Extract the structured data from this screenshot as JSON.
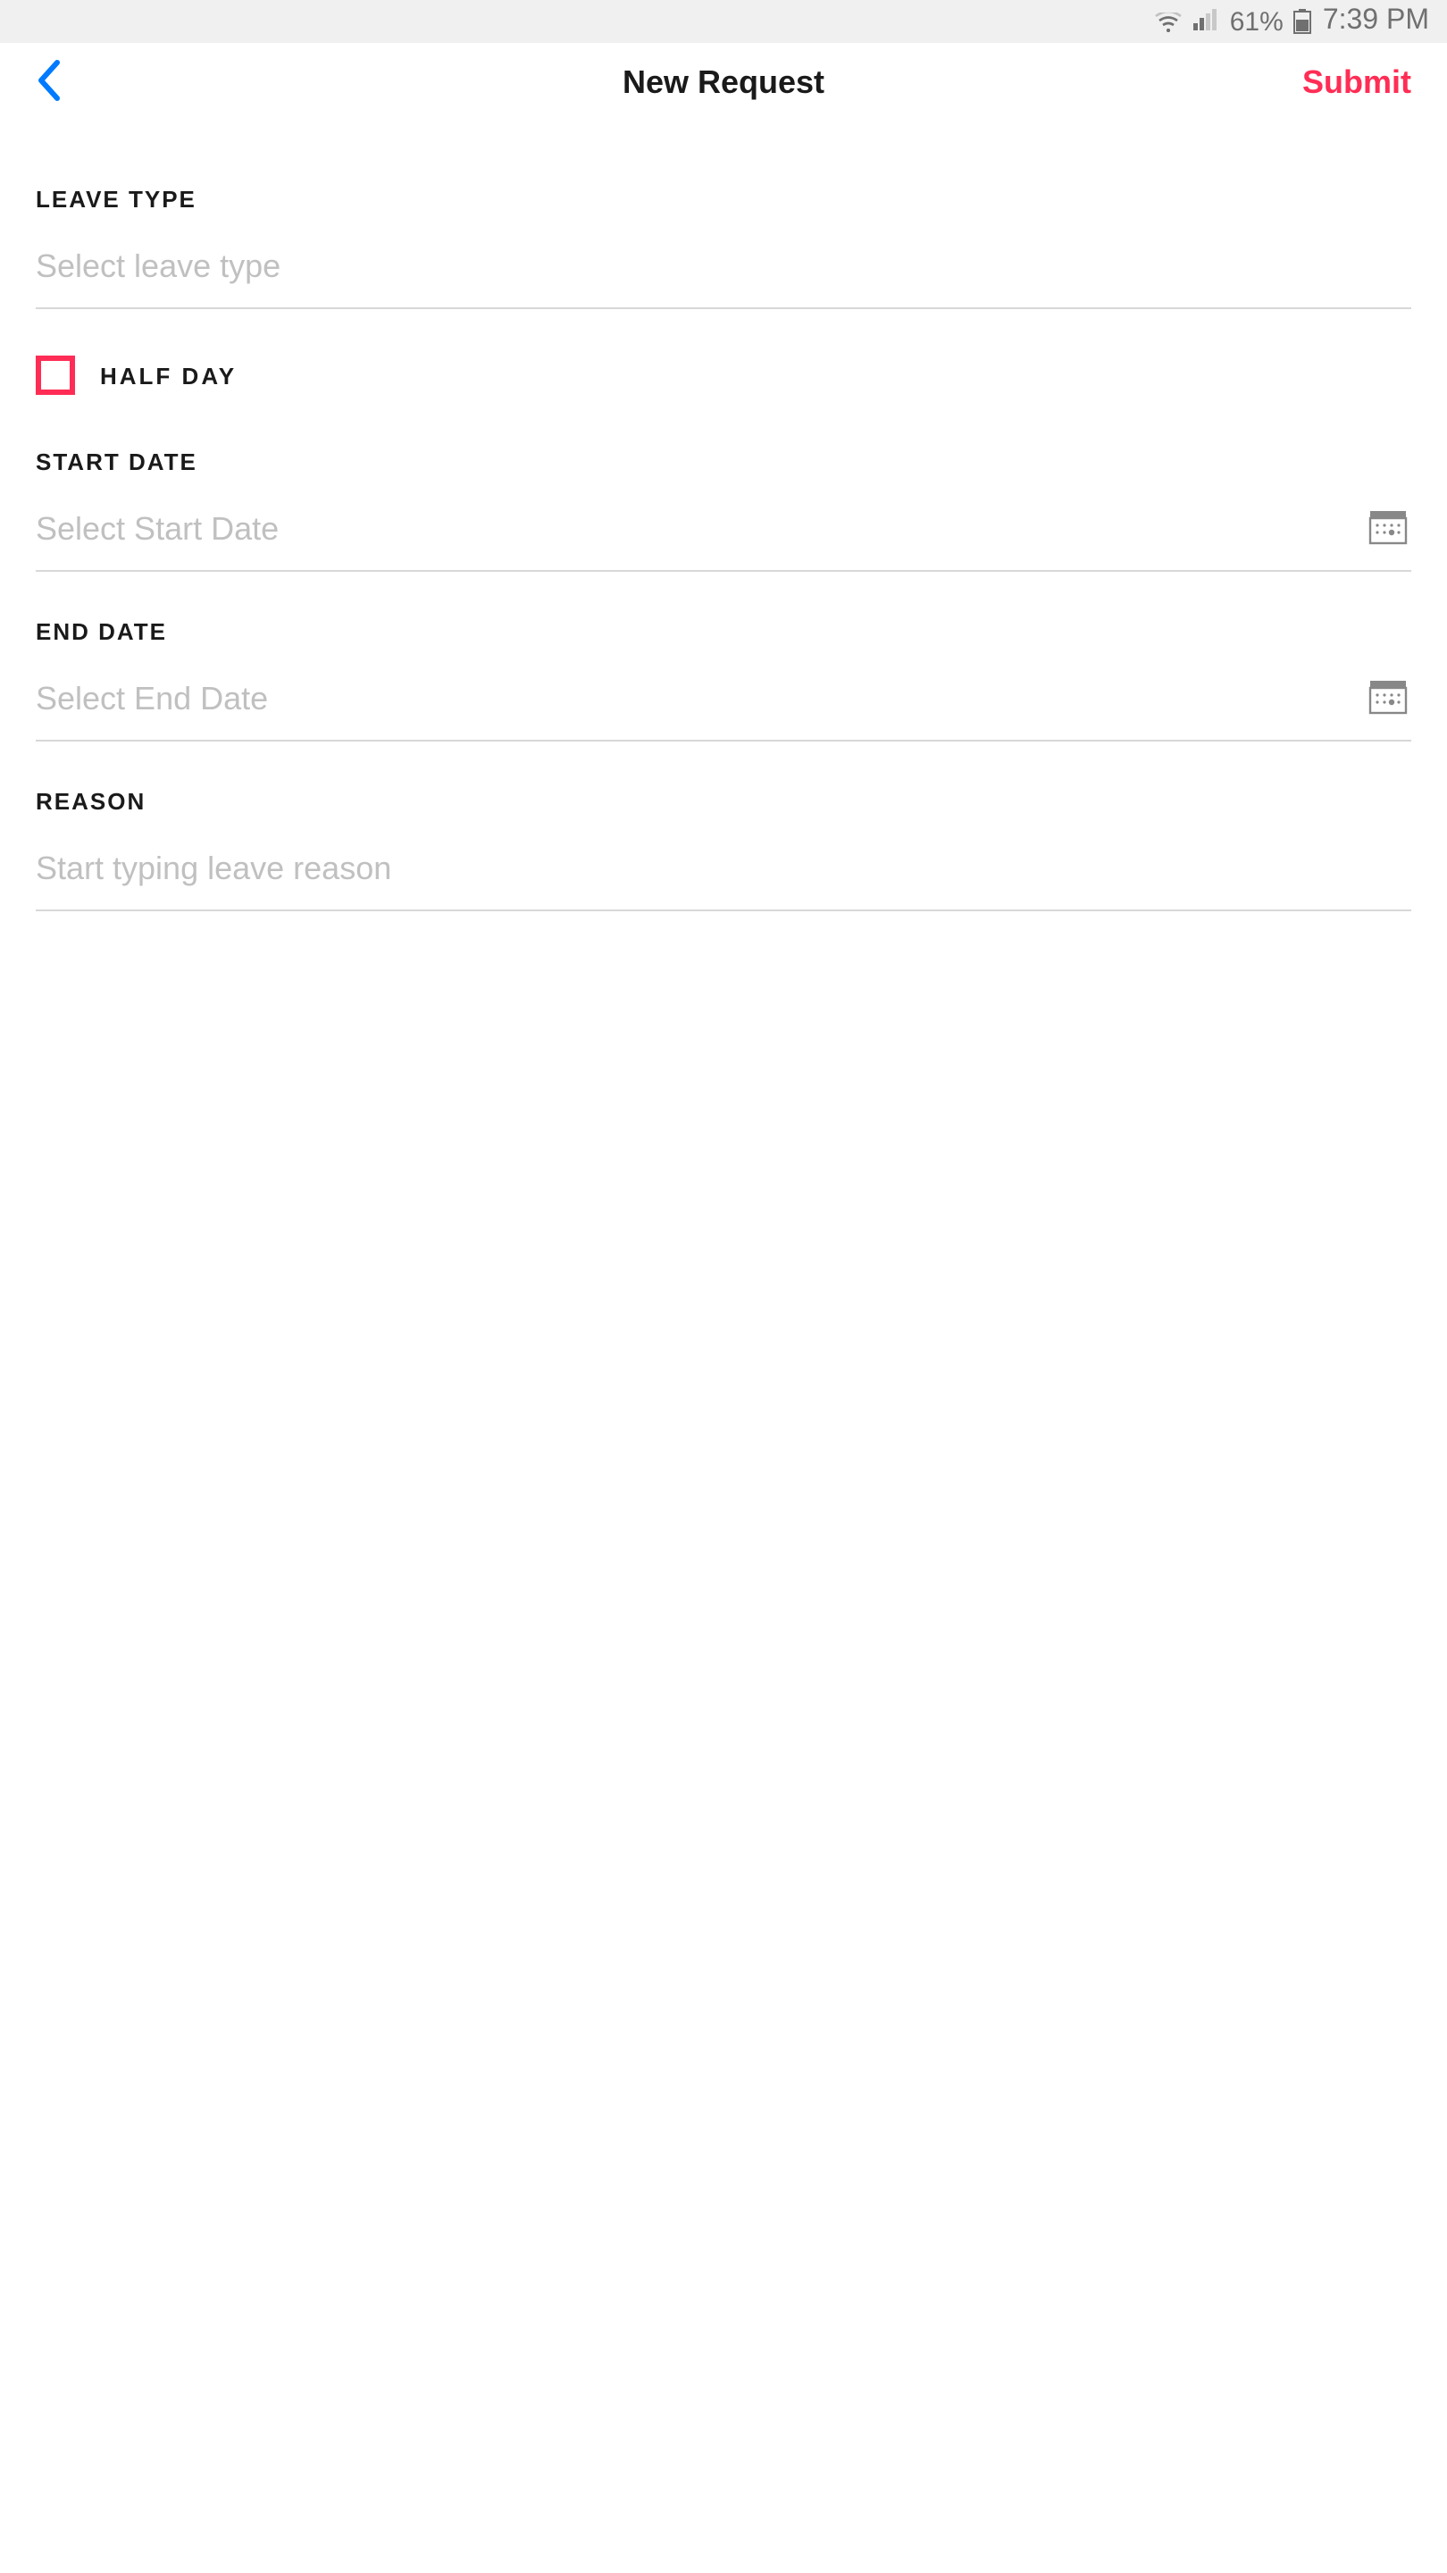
{
  "status_bar": {
    "battery_percent": "61%",
    "time": "7:39 PM"
  },
  "nav": {
    "title": "New Request",
    "submit_label": "Submit"
  },
  "form": {
    "leave_type": {
      "label": "LEAVE TYPE",
      "placeholder": "Select leave type"
    },
    "half_day": {
      "label": "HALF DAY",
      "checked": false
    },
    "start_date": {
      "label": "START DATE",
      "placeholder": "Select Start Date"
    },
    "end_date": {
      "label": "END DATE",
      "placeholder": "Select End Date"
    },
    "reason": {
      "label": "REASON",
      "placeholder": "Start typing leave reason"
    }
  },
  "colors": {
    "accent": "#ff2d55",
    "ios_blue": "#007aff"
  }
}
